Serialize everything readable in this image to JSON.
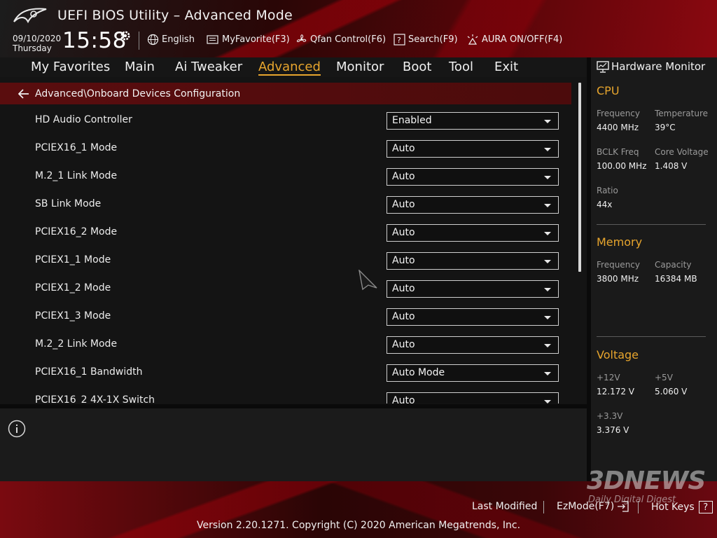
{
  "header": {
    "title": "UEFI BIOS Utility – Advanced Mode",
    "date": "09/10/2020",
    "day": "Thursday",
    "time": "15:58",
    "tools": [
      {
        "label": "English",
        "icon": "globe-icon"
      },
      {
        "label": "MyFavorite(F3)",
        "icon": "favorite-icon"
      },
      {
        "label": "Qfan Control(F6)",
        "icon": "fan-icon"
      },
      {
        "label": "Search(F9)",
        "icon": "search-icon"
      },
      {
        "label": "AURA ON/OFF(F4)",
        "icon": "aura-icon"
      }
    ]
  },
  "tabs": [
    {
      "label": "My Favorites",
      "active": false
    },
    {
      "label": "Main",
      "active": false
    },
    {
      "label": "Ai Tweaker",
      "active": false
    },
    {
      "label": "Advanced",
      "active": true
    },
    {
      "label": "Monitor",
      "active": false
    },
    {
      "label": "Boot",
      "active": false
    },
    {
      "label": "Tool",
      "active": false
    },
    {
      "label": "Exit",
      "active": false
    }
  ],
  "breadcrumb": "Advanced\\Onboard Devices Configuration",
  "settings": [
    {
      "label": "HD Audio Controller",
      "value": "Enabled"
    },
    {
      "label": "PCIEX16_1 Mode",
      "value": "Auto"
    },
    {
      "label": "M.2_1 Link Mode",
      "value": "Auto"
    },
    {
      "label": "SB Link Mode",
      "value": "Auto"
    },
    {
      "label": "PCIEX16_2 Mode",
      "value": "Auto"
    },
    {
      "label": "PCIEX1_1 Mode",
      "value": "Auto"
    },
    {
      "label": "PCIEX1_2 Mode",
      "value": "Auto"
    },
    {
      "label": "PCIEX1_3 Mode",
      "value": "Auto"
    },
    {
      "label": "M.2_2 Link Mode",
      "value": "Auto"
    },
    {
      "label": "PCIEX16_1 Bandwidth",
      "value": "Auto Mode"
    },
    {
      "label": "PCIEX16_2 4X-1X Switch",
      "value": "Auto"
    }
  ],
  "hardware_monitor": {
    "title": "Hardware Monitor",
    "cpu": {
      "heading": "CPU",
      "frequency_label": "Frequency",
      "frequency": "4400 MHz",
      "temperature_label": "Temperature",
      "temperature": "39°C",
      "bclk_label": "BCLK Freq",
      "bclk": "100.00 MHz",
      "core_voltage_label": "Core Voltage",
      "core_voltage": "1.408 V",
      "ratio_label": "Ratio",
      "ratio": "44x"
    },
    "memory": {
      "heading": "Memory",
      "frequency_label": "Frequency",
      "frequency": "3800 MHz",
      "capacity_label": "Capacity",
      "capacity": "16384 MB"
    },
    "voltage": {
      "heading": "Voltage",
      "v12_label": "+12V",
      "v12": "12.172 V",
      "v5_label": "+5V",
      "v5": "5.060 V",
      "v33_label": "+3.3V",
      "v33": "3.376 V"
    }
  },
  "footer": {
    "last_modified": "Last Modified",
    "ezmode": "EzMode(F7)",
    "hotkeys": "Hot Keys",
    "hotkeys_glyph": "?",
    "copyright": "Version 2.20.1271. Copyright (C) 2020 American Megatrends, Inc."
  },
  "watermark": {
    "big": "3DNEWS",
    "small": "Daily Digital Digest"
  },
  "colors": {
    "accent": "#e7a52d",
    "crumb_bg": "#5a0d0e",
    "brand_red": "#8a0810"
  }
}
